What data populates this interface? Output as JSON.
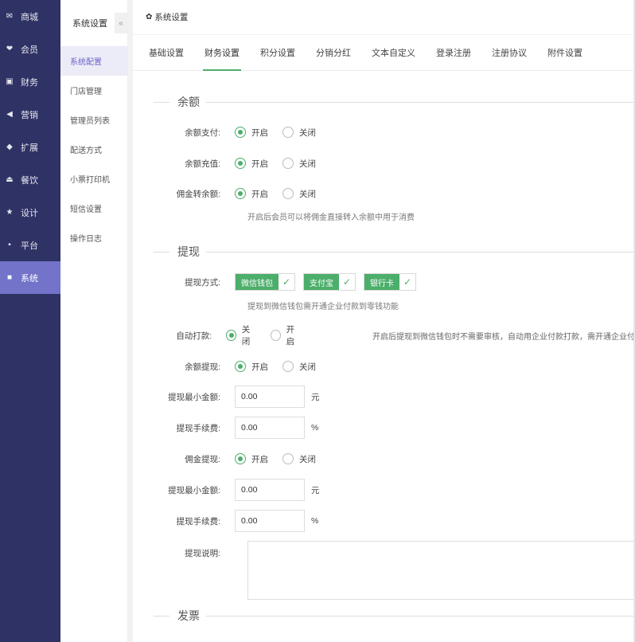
{
  "nav": [
    {
      "icon": "shop-icon",
      "glyph": "✉",
      "label": "商城"
    },
    {
      "icon": "member-icon",
      "glyph": "❤",
      "label": "会员"
    },
    {
      "icon": "finance-icon",
      "glyph": "▣",
      "label": "财务"
    },
    {
      "icon": "marketing-icon",
      "glyph": "◀",
      "label": "营销"
    },
    {
      "icon": "extend-icon",
      "glyph": "◆",
      "label": "扩展"
    },
    {
      "icon": "dining-icon",
      "glyph": "⏏",
      "label": "餐饮"
    },
    {
      "icon": "design-icon",
      "glyph": "★",
      "label": "设计"
    },
    {
      "icon": "platform-icon",
      "glyph": "▪",
      "label": "平台"
    },
    {
      "icon": "system-icon",
      "glyph": "■",
      "label": "系统",
      "active": true
    }
  ],
  "subnav": {
    "title": "系统设置",
    "collapse": "«",
    "items": [
      "系统配置",
      "门店管理",
      "管理员列表",
      "配送方式",
      "小票打印机",
      "短信设置",
      "操作日志"
    ]
  },
  "main": {
    "title": "系统设置",
    "gear": "✿",
    "tabs": [
      "基础设置",
      "财务设置",
      "积分设置",
      "分销分红",
      "文本自定义",
      "登录注册",
      "注册协议",
      "附件设置"
    ],
    "active_tab": 1
  },
  "balance": {
    "section": "余额",
    "rows": [
      {
        "label": "余额支付:",
        "on": "开启",
        "off": "关闭",
        "selected": "on"
      },
      {
        "label": "余额充值:",
        "on": "开启",
        "off": "关闭",
        "selected": "on"
      },
      {
        "label": "佣金转余额:",
        "on": "开启",
        "off": "关闭",
        "selected": "on"
      }
    ],
    "hint": "开启后会员可以将佣金直接转入余额中用于消费"
  },
  "withdraw": {
    "section": "提现",
    "method_label": "提现方式:",
    "methods": [
      "微信钱包",
      "支付宝",
      "银行卡"
    ],
    "check_glyph": "✓",
    "method_hint": "提现到微信钱包需开通企业付款到零钱功能",
    "auto_label": "自动打款:",
    "auto_first": "关闭",
    "auto_second": "开启",
    "auto_hint": "开启后提现到微信钱包时不需要审核，自动用企业付款打款，需开通企业付",
    "balance_w_label": "余额提现:",
    "balance_w_on": "开启",
    "balance_w_off": "关闭",
    "min1_label": "提现最小金额:",
    "min1_value": "0.00",
    "min1_unit": "元",
    "fee1_label": "提现手续费:",
    "fee1_value": "0.00",
    "fee1_unit": "%",
    "comm_label": "佣金提现:",
    "comm_on": "开启",
    "comm_off": "关闭",
    "min2_label": "提现最小金额:",
    "min2_value": "0.00",
    "min2_unit": "元",
    "fee2_label": "提现手续费:",
    "fee2_value": "0.00",
    "fee2_unit": "%",
    "desc_label": "提现说明:"
  },
  "invoice": {
    "section": "发票"
  },
  "colors": {
    "nav_bg": "#2f3264",
    "nav_active": "#7273c9",
    "accent": "#4cae6b"
  }
}
